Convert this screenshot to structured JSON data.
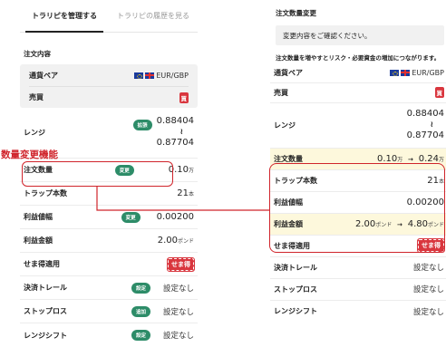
{
  "annotation": {
    "label": "数量変更機能"
  },
  "left": {
    "tabs": [
      {
        "label": "トラリピを管理する",
        "active": true
      },
      {
        "label": "トラリピの履歴を見る",
        "active": false
      }
    ],
    "order_title": "注文内容",
    "pair": {
      "label": "通貨ペア",
      "value": "EUR/GBP"
    },
    "trade": {
      "label": "売買",
      "value": "買"
    },
    "range": {
      "label": "レンジ",
      "badge": "拡張",
      "upper": "0.88404",
      "tilde": "≀",
      "lower": "0.87704"
    },
    "quantity": {
      "label": "注文数量",
      "badge": "変更",
      "value": "0.10",
      "unit": "万"
    },
    "traps": {
      "label": "トラップ本数",
      "value": "21",
      "unit": "本"
    },
    "profit_width": {
      "label": "利益値幅",
      "badge": "変更",
      "value": "0.00200"
    },
    "profit_amount": {
      "label": "利益金額",
      "value": "2.00",
      "unit": "ポンド"
    },
    "semayoku": {
      "label": "せま得適用",
      "logo": "せま得"
    },
    "settle_trail": {
      "label": "決済トレール",
      "badge": "設定",
      "value": "設定なし"
    },
    "stop_loss": {
      "label": "ストップロス",
      "badge": "追加",
      "value": "設定なし"
    },
    "range_shift": {
      "label": "レンジシフト",
      "badge": "設定",
      "value": "設定なし"
    }
  },
  "right": {
    "title": "注文数量変更",
    "confirm": "変更内容をご確認ください。",
    "notice": "注文数量を増やすとリスク・必要資金の増加につながります。",
    "pair": {
      "label": "通貨ペア",
      "value": "EUR/GBP"
    },
    "trade": {
      "label": "売買",
      "value": "買"
    },
    "range": {
      "label": "レンジ",
      "upper": "0.88404",
      "tilde": "≀",
      "lower": "0.87704"
    },
    "quantity": {
      "label": "注文数量",
      "from": "0.10",
      "to": "0.24",
      "unit": "万",
      "arrow": "→"
    },
    "traps": {
      "label": "トラップ本数",
      "value": "21",
      "unit": "本"
    },
    "profit_width": {
      "label": "利益値幅",
      "value": "0.00200"
    },
    "profit_amount": {
      "label": "利益金額",
      "from": "2.00",
      "to": "4.80",
      "unit": "ポンド",
      "arrow": "→"
    },
    "semayoku": {
      "label": "せま得適用",
      "logo": "せま得"
    },
    "settle_trail": {
      "label": "決済トレール",
      "value": "設定なし"
    },
    "stop_loss": {
      "label": "ストップロス",
      "value": "設定なし"
    },
    "range_shift": {
      "label": "レンジシフト",
      "value": "設定なし"
    }
  },
  "colors": {
    "accent_red": "#d0242b",
    "badge_green": "#2d8c68",
    "highlight": "#fdf8dc"
  }
}
